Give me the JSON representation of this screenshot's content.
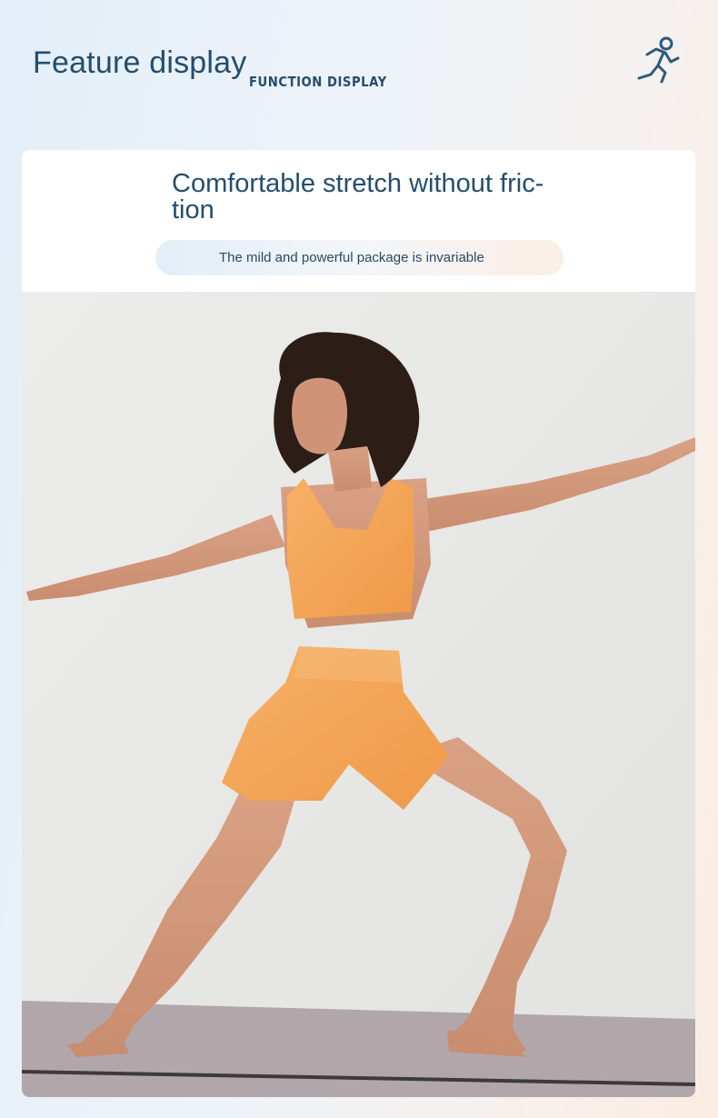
{
  "header": {
    "title": "Feature display",
    "subtitle": "FUNCTION DISPLAY",
    "icon": "running-person-icon"
  },
  "card": {
    "title_line1": "Comfortable stretch without fric-",
    "title_line2": "tion",
    "pill_text": "The mild and powerful package is invariable"
  },
  "photo": {
    "subject": "yoga-model-photo"
  },
  "colors": {
    "text_primary": "#244d6e",
    "garment": "#f4a85a",
    "photo_bg": "#e6e6e4"
  }
}
